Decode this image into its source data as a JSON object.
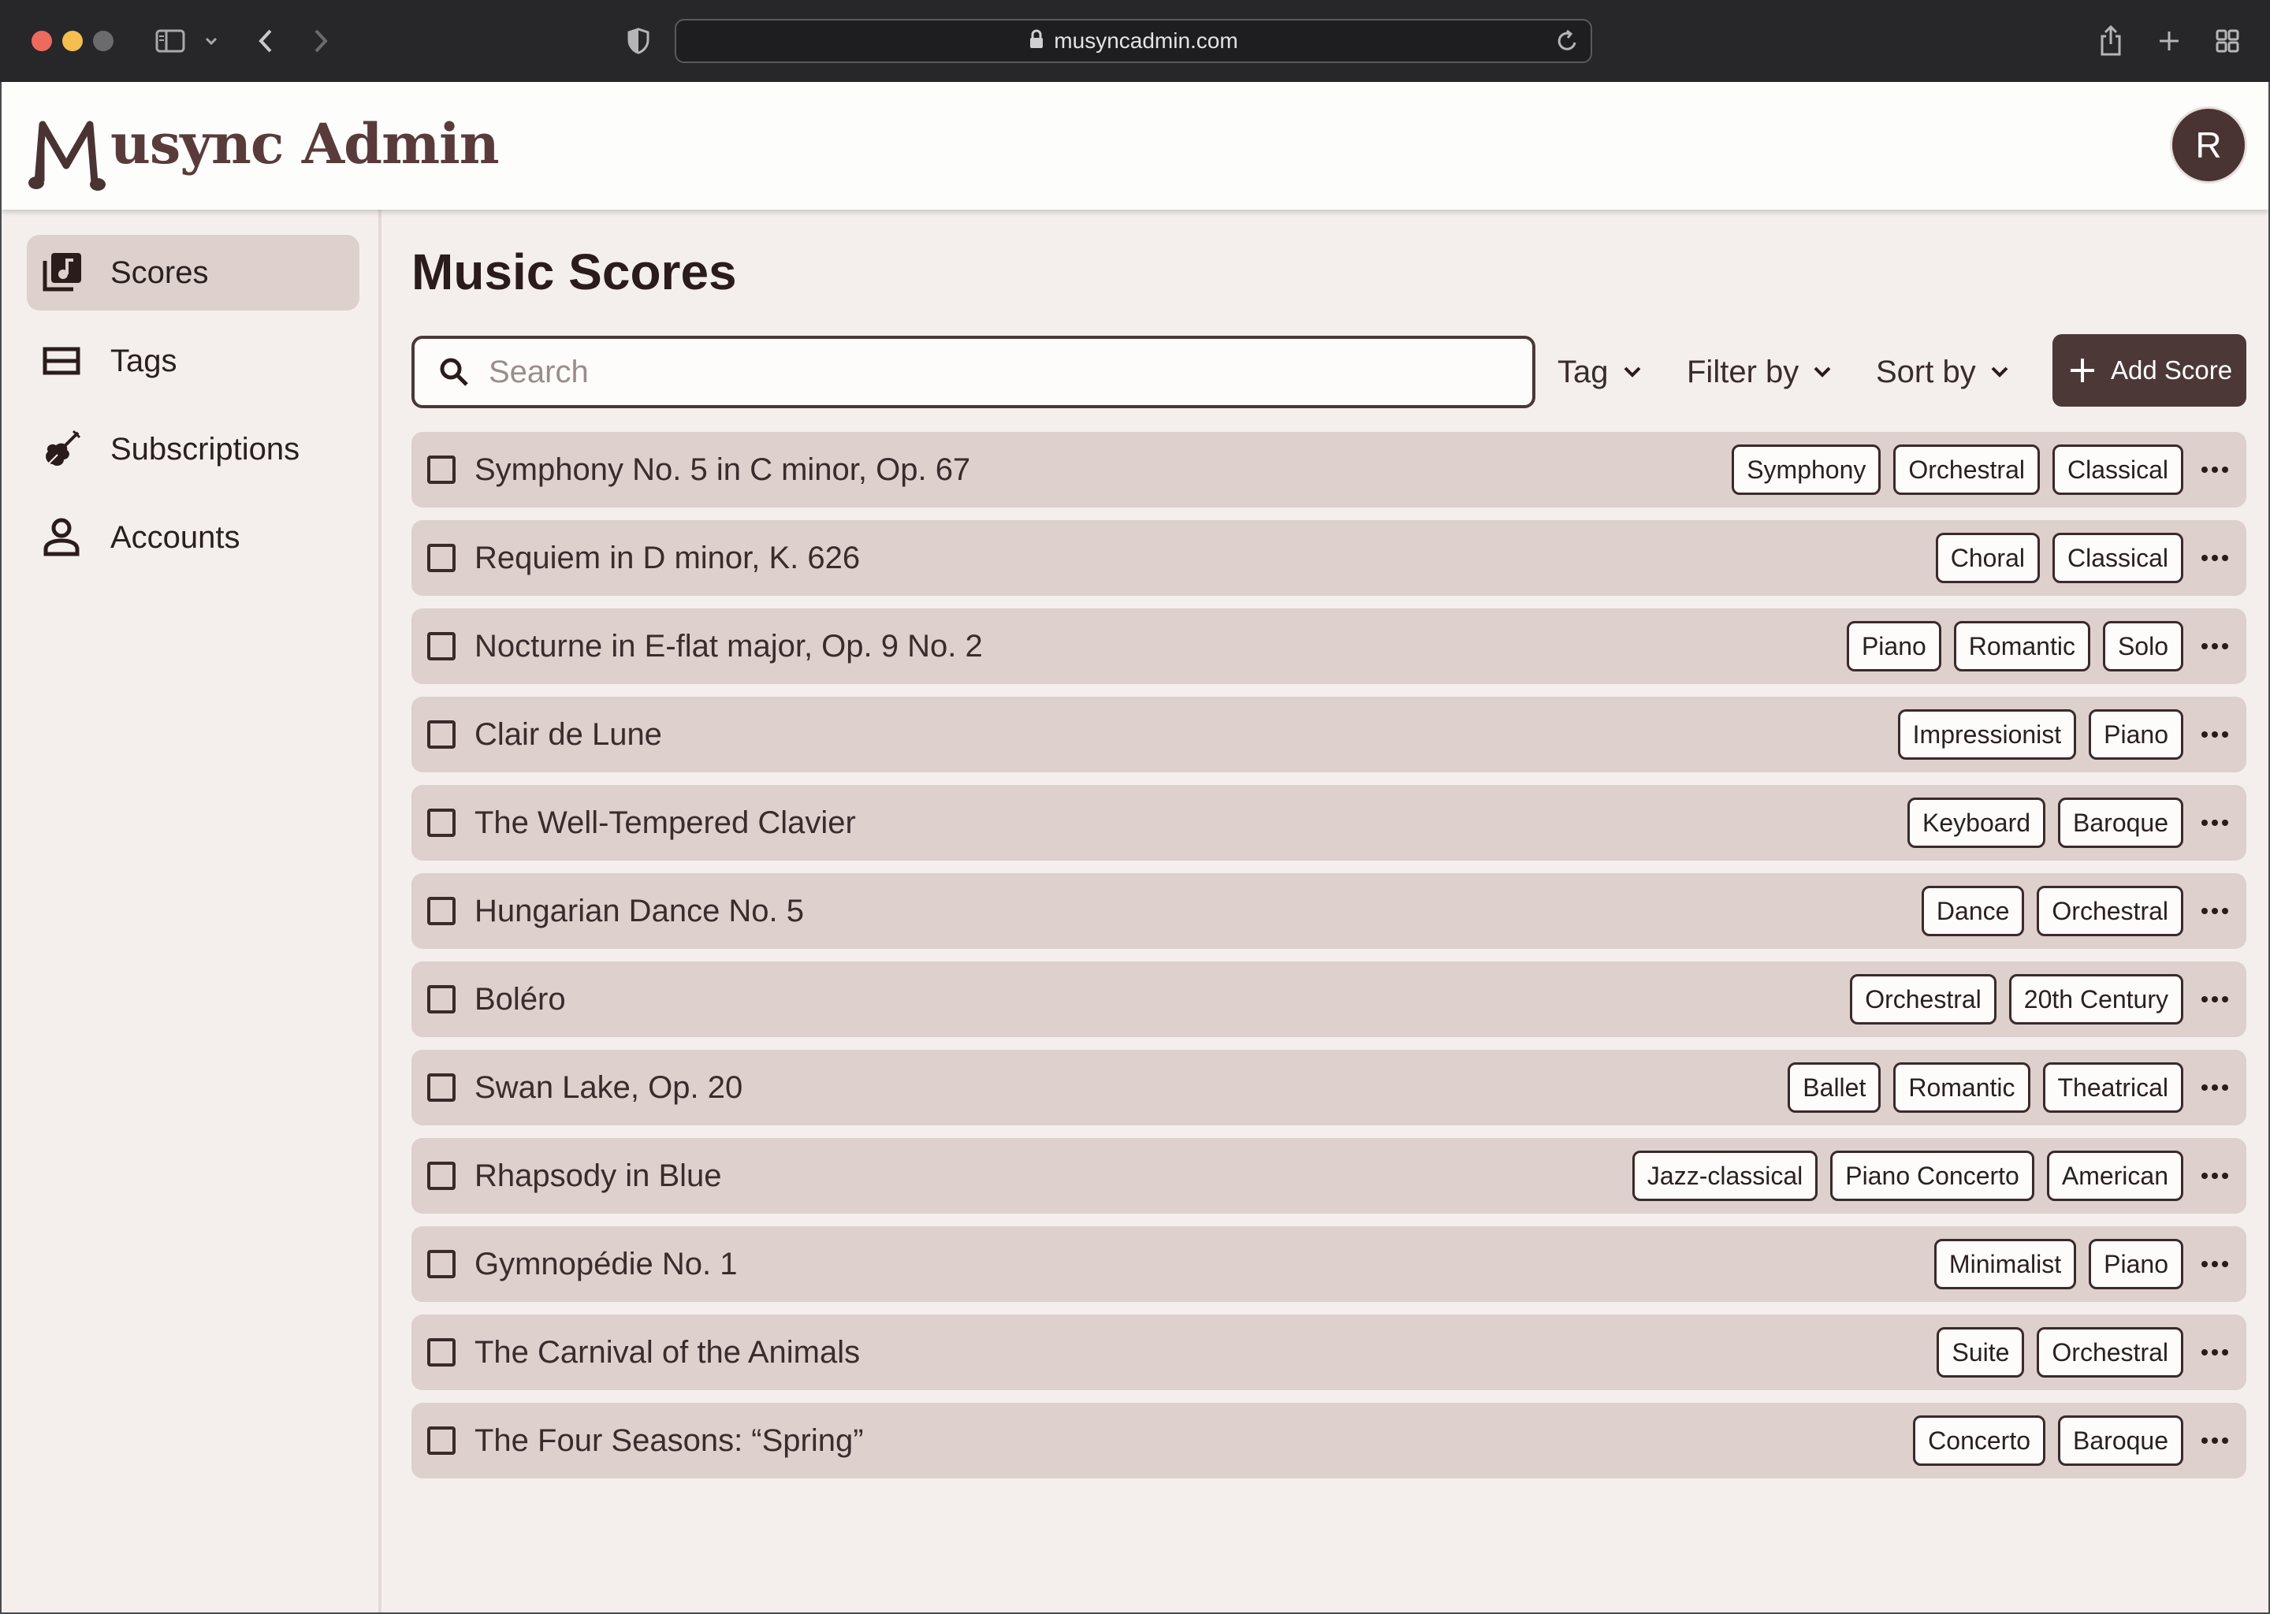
{
  "browser": {
    "url": "musyncadmin.com",
    "icons": [
      "sidebar-toggle-icon",
      "chevron-down-icon",
      "back-icon",
      "forward-icon",
      "shield-icon",
      "lock-icon",
      "reload-icon",
      "share-icon",
      "new-tab-icon",
      "tab-overview-icon"
    ]
  },
  "app": {
    "logo_letter": "M",
    "logo_rest": "usync Admin",
    "avatar_initial": "R"
  },
  "sidebar": {
    "items": [
      {
        "label": "Scores",
        "icon": "music-library-icon",
        "active": true
      },
      {
        "label": "Tags",
        "icon": "tag-list-icon",
        "active": false
      },
      {
        "label": "Subscriptions",
        "icon": "violin-icon",
        "active": false
      },
      {
        "label": "Accounts",
        "icon": "person-icon",
        "active": false
      }
    ]
  },
  "main": {
    "title": "Music Scores",
    "search_placeholder": "Search",
    "filters": {
      "tag": "Tag",
      "filter_by": "Filter by",
      "sort_by": "Sort by"
    },
    "add_button": "Add Score",
    "scores": [
      {
        "title": "Symphony No. 5 in C minor, Op. 67",
        "tags": [
          "Symphony",
          "Orchestral",
          "Classical"
        ]
      },
      {
        "title": "Requiem in D minor, K. 626",
        "tags": [
          "Choral",
          "Classical"
        ]
      },
      {
        "title": "Nocturne in E-flat major, Op. 9 No. 2",
        "tags": [
          "Piano",
          "Romantic",
          "Solo"
        ]
      },
      {
        "title": "Clair de Lune",
        "tags": [
          "Impressionist",
          "Piano"
        ]
      },
      {
        "title": "The Well-Tempered Clavier",
        "tags": [
          "Keyboard",
          "Baroque"
        ]
      },
      {
        "title": "Hungarian Dance No. 5",
        "tags": [
          "Dance",
          "Orchestral"
        ]
      },
      {
        "title": "Boléro",
        "tags": [
          "Orchestral",
          "20th Century"
        ]
      },
      {
        "title": "Swan Lake, Op. 20",
        "tags": [
          "Ballet",
          "Romantic",
          "Theatrical"
        ]
      },
      {
        "title": "Rhapsody in Blue",
        "tags": [
          "Jazz-classical",
          "Piano Concerto",
          "American"
        ]
      },
      {
        "title": "Gymnopédie No. 1",
        "tags": [
          "Minimalist",
          "Piano"
        ]
      },
      {
        "title": "The Carnival of the Animals",
        "tags": [
          "Suite",
          "Orchestral"
        ]
      },
      {
        "title": "The Four Seasons: “Spring”",
        "tags": [
          "Concerto",
          "Baroque"
        ]
      }
    ]
  },
  "colors": {
    "brand": "#4d3838",
    "row_bg": "#ddd0cd",
    "page_bg": "#f4efed",
    "logo": "#5a3b3b"
  }
}
